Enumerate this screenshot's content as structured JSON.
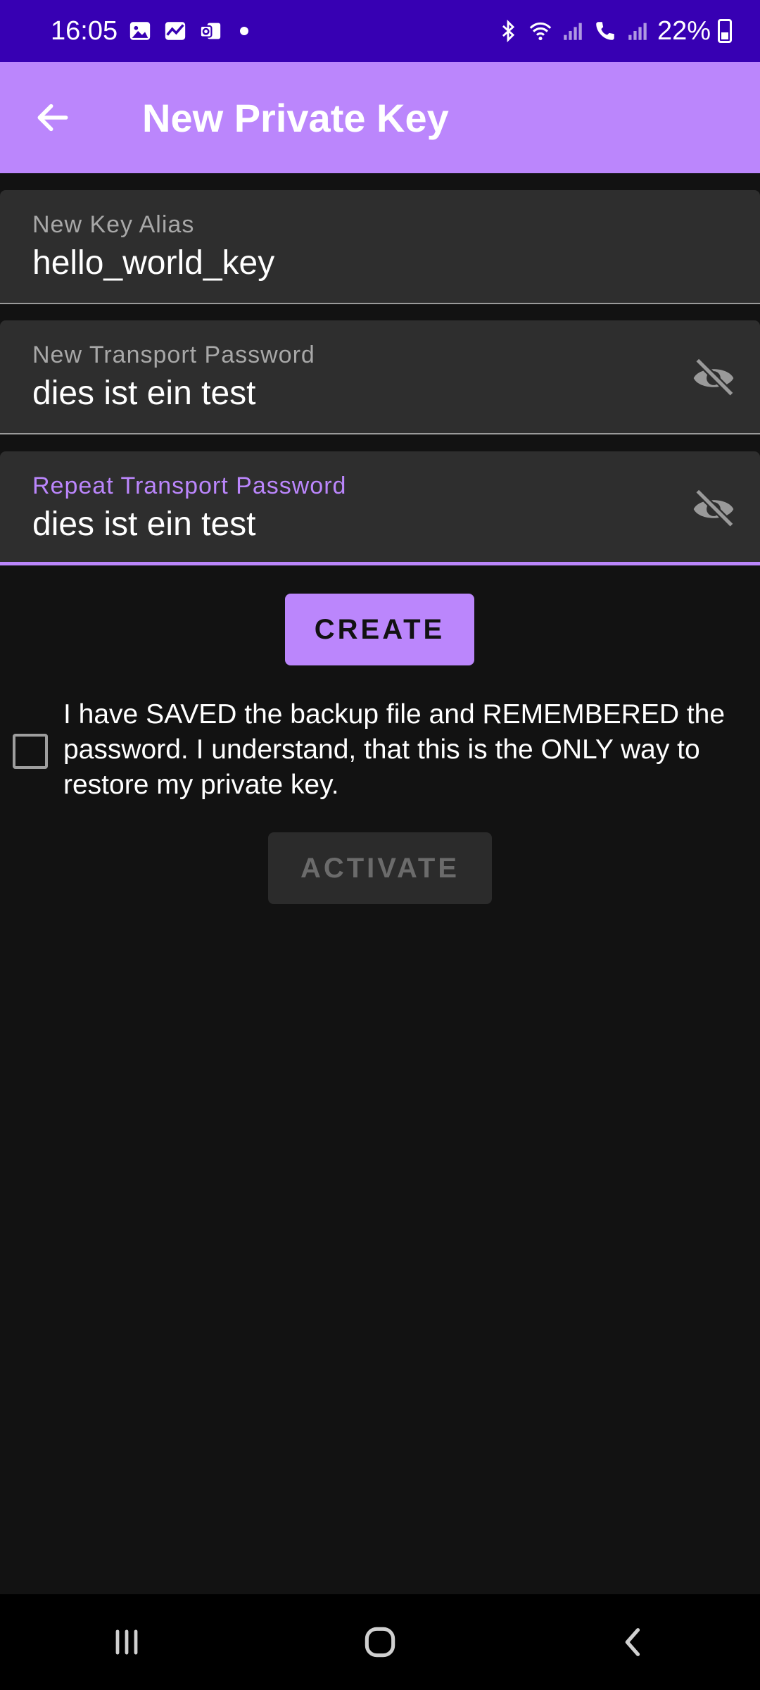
{
  "status_bar": {
    "time": "16:05",
    "battery": "22%",
    "icons": [
      "gallery-icon",
      "chart-icon",
      "outlook-icon",
      "dot",
      "bluetooth-icon",
      "wifi-icon",
      "signal-icon",
      "call-icon",
      "signal-icon",
      "battery-icon"
    ]
  },
  "app_bar": {
    "title": "New Private Key",
    "back_icon": "arrow-left-icon",
    "background": "#bb86fc"
  },
  "form": {
    "alias": {
      "label": "New Key Alias",
      "value": "hello_world_key"
    },
    "password": {
      "label": "New Transport Password",
      "value": "dies ist ein test",
      "toggle_icon": "eye-off-icon"
    },
    "repeat_password": {
      "label": "Repeat Transport Password",
      "value": "dies ist ein test",
      "toggle_icon": "eye-off-icon",
      "focused": true
    }
  },
  "actions": {
    "create_label": "CREATE",
    "consent_text": "I have SAVED the backup file and REMEMBERED the password. I understand, that this is the ONLY way to restore my private key.",
    "consent_checked": false,
    "activate_label": "ACTIVATE",
    "activate_enabled": false
  },
  "nav_bar": {
    "buttons": [
      "recents-icon",
      "home-icon",
      "back-icon"
    ]
  },
  "colors": {
    "accent": "#bb86fc",
    "status_bar": "#3700b3",
    "background": "#121212",
    "field": "#2e2e2e"
  }
}
